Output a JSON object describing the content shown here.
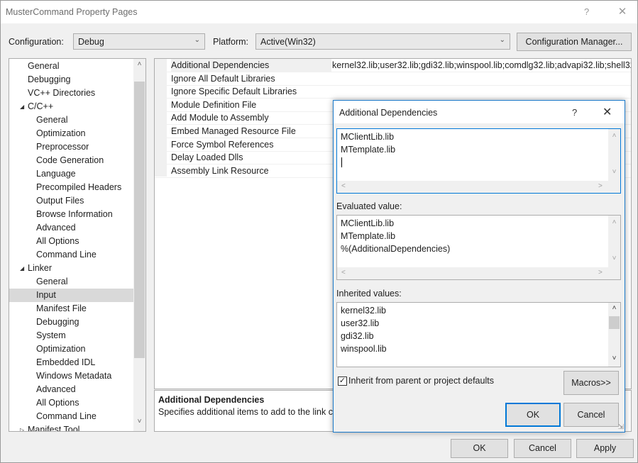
{
  "window": {
    "title": "MusterCommand Property Pages",
    "help": "?",
    "close": "✕"
  },
  "toolbar": {
    "configuration_label": "Configuration:",
    "configuration_value": "Debug",
    "platform_label": "Platform:",
    "platform_value": "Active(Win32)",
    "config_manager_label": "Configuration Manager..."
  },
  "tree": [
    "General",
    "Debugging",
    "VC++ Directories",
    "C/C++",
    "General",
    "Optimization",
    "Preprocessor",
    "Code Generation",
    "Language",
    "Precompiled Headers",
    "Output Files",
    "Browse Information",
    "Advanced",
    "All Options",
    "Command Line",
    "Linker",
    "General",
    "Input",
    "Manifest File",
    "Debugging",
    "System",
    "Optimization",
    "Embedded IDL",
    "Windows Metadata",
    "Advanced",
    "All Options",
    "Command Line",
    "Manifest Tool"
  ],
  "properties": [
    {
      "name": "Additional Dependencies",
      "value": "kernel32.lib;user32.lib;gdi32.lib;winspool.lib;comdlg32.lib;advapi32.lib;shell32"
    },
    {
      "name": "Ignore All Default Libraries",
      "value": ""
    },
    {
      "name": "Ignore Specific Default Libraries",
      "value": ""
    },
    {
      "name": "Module Definition File",
      "value": ""
    },
    {
      "name": "Add Module to Assembly",
      "value": ""
    },
    {
      "name": "Embed Managed Resource File",
      "value": ""
    },
    {
      "name": "Force Symbol References",
      "value": ""
    },
    {
      "name": "Delay Loaded Dlls",
      "value": ""
    },
    {
      "name": "Assembly Link Resource",
      "value": ""
    }
  ],
  "description": {
    "heading": "Additional Dependencies",
    "text": "Specifies additional items to add to the link c"
  },
  "footer": {
    "ok": "OK",
    "cancel": "Cancel",
    "apply": "Apply"
  },
  "dialog": {
    "title": "Additional Dependencies",
    "help": "?",
    "close": "✕",
    "edit_lines": [
      "MClientLib.lib",
      "MTemplate.lib"
    ],
    "evaluated_label": "Evaluated value:",
    "evaluated_lines": [
      "MClientLib.lib",
      "MTemplate.lib",
      "%(AdditionalDependencies)"
    ],
    "inherited_label": "Inherited values:",
    "inherited_lines": [
      "kernel32.lib",
      "user32.lib",
      "gdi32.lib",
      "winspool.lib"
    ],
    "inherit_checkbox_label": "Inherit from parent or project defaults",
    "inherit_checked": true,
    "macros_label": "Macros>>",
    "ok": "OK",
    "cancel": "Cancel"
  },
  "icons": {
    "expand": "chevron-down-icon",
    "collapsed": "chevron-right-icon",
    "scroll_up": "chevron-up-icon",
    "scroll_down": "chevron-down-icon",
    "scroll_left": "chevron-left-icon",
    "scroll_right": "chevron-right-icon"
  },
  "colors": {
    "accent": "#0078d7",
    "selection": "#d9d9d9",
    "window_bg": "#f0f0f0"
  }
}
